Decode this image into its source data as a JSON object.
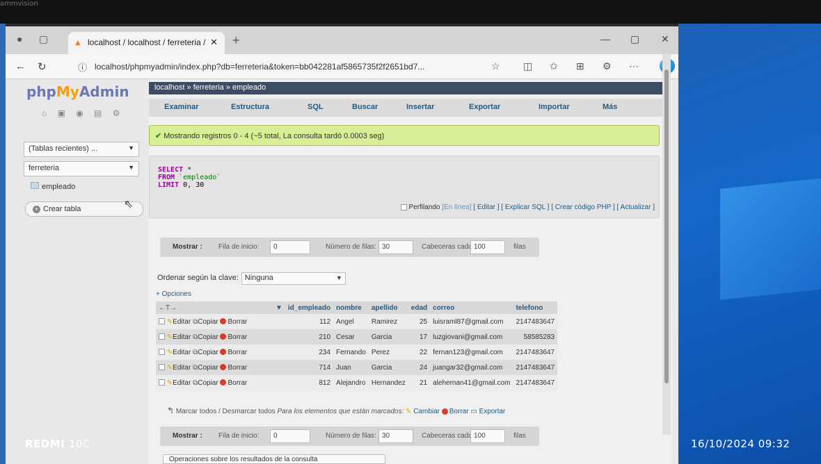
{
  "monitor": {
    "brand": "ammvision"
  },
  "browser": {
    "tab_title": "localhost / localhost / ferreteria /",
    "url": "localhost/phpmyadmin/index.php?db=ferreteria&token=bb042281af5865735f2f2651bd7..."
  },
  "sidebar": {
    "logo_php": "php",
    "logo_my": "My",
    "logo_admin": "Admin",
    "recent_select": "(Tablas recientes) ...",
    "db_select": "ferreteria",
    "table_item": "empleado",
    "create_table": "Crear tabla"
  },
  "breadcrumb": {
    "server": "localhost",
    "sep1": "»",
    "db": "ferreteria",
    "sep2": "»",
    "table": "empleado"
  },
  "menu": [
    "Examinar",
    "Estructura",
    "SQL",
    "Buscar",
    "Insertar",
    "Exportar",
    "Importar",
    "Más"
  ],
  "message": {
    "text_a": "Mostrando registros 0 - 4 (",
    "text_b": "~5 total",
    "text_c": ", La consulta tardó 0.0003 seg)"
  },
  "sql": {
    "select": "SELECT",
    "star": "*",
    "from": "FROM",
    "table": "`empleado`",
    "limit": "LIMIT",
    "limit_val": "0, 30"
  },
  "sql_links": {
    "perfilando": "Perfilando",
    "en_linea": "[En línea]",
    "editar": "[ Editar ]",
    "explicar": "[ Explicar SQL ]",
    "crear_php": "[ Crear código PHP ]",
    "actualizar": "[ Actualizar ]"
  },
  "nav": {
    "mostrar": "Mostrar :",
    "fila_inicio_label": "Fila de inicio:",
    "fila_inicio": "0",
    "num_filas_label": "Número de filas:",
    "num_filas": "30",
    "cabeceras_label": "Cabeceras cada",
    "cabeceras": "100",
    "filas_label": "filas"
  },
  "sort": {
    "label": "Ordenar según la clave:",
    "value": "Ninguna"
  },
  "options_link": "+ Opciones",
  "table": {
    "columns": [
      "id_empleado",
      "nombre",
      "apellido",
      "edad",
      "correo",
      "telefono"
    ],
    "actions": {
      "edit": "Editar",
      "copy": "Copiar",
      "delete": "Borrar"
    },
    "rows": [
      {
        "id": "112",
        "nombre": "Angel",
        "apellido": "Ramirez",
        "edad": "25",
        "correo": "luisraml87@gmail.com",
        "telefono": "2147483647"
      },
      {
        "id": "210",
        "nombre": "Cesar",
        "apellido": "Garcia",
        "edad": "17",
        "correo": "luzgiovani@gmail.com",
        "telefono": "58585283"
      },
      {
        "id": "234",
        "nombre": "Fernando",
        "apellido": "Perez",
        "edad": "22",
        "correo": "fernan123@gmail.com",
        "telefono": "2147483647"
      },
      {
        "id": "714",
        "nombre": "Juan",
        "apellido": "Garcia",
        "edad": "24",
        "correo": "juangar32@gmail.com",
        "telefono": "2147483647"
      },
      {
        "id": "812",
        "nombre": "Alejandro",
        "apellido": "Hernandez",
        "edad": "21",
        "correo": "alehernan41@gmail.com",
        "telefono": "2147483647"
      }
    ]
  },
  "bulk": {
    "marcar": "Marcar todos",
    "sep": " / ",
    "desmarcar": "Desmarcar todos",
    "para": "Para los elementos que están marcados:",
    "cambiar": "Cambiar",
    "borrar": "Borrar",
    "exportar": "Exportar"
  },
  "operaciones": "Operaciones sobre los resultados de la consulta",
  "watermark": {
    "brand": "REDMI",
    "model": "10C",
    "datetime": "16/10/2024 09:32"
  }
}
